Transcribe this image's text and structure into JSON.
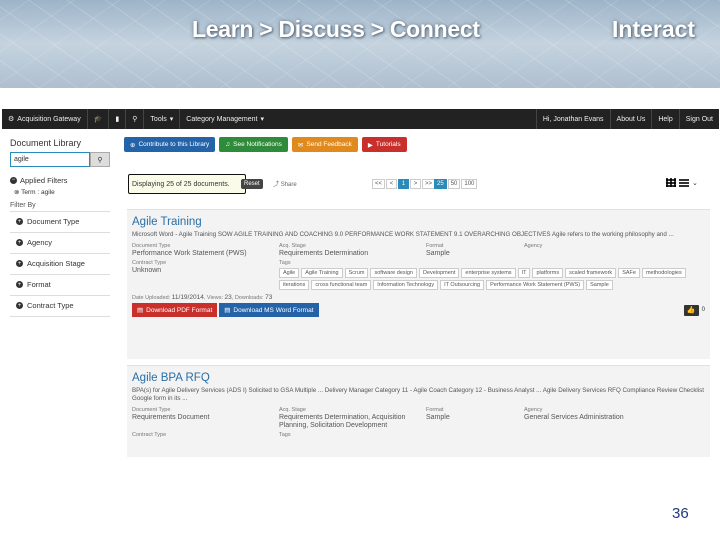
{
  "banner": {
    "title": "Learn > Discuss > Connect",
    "interact": "Interact"
  },
  "nav": {
    "brand": "Acquisition Gateway",
    "tools": "Tools",
    "category": "Category Management",
    "greeting": "Hi, Jonathan Evans",
    "about": "About Us",
    "help": "Help",
    "signout": "Sign Out"
  },
  "sidebar": {
    "title": "Document Library",
    "search_value": "agile",
    "applied_filters": "Applied Filters",
    "term": "Term : agile",
    "filter_by": "Filter By",
    "facets": [
      "Document Type",
      "Agency",
      "Acquisition Stage",
      "Format",
      "Contract Type"
    ]
  },
  "actions": {
    "contribute": "Contribute to this Library",
    "notifications": "See Notifications",
    "feedback": "Send Feedback",
    "tutorials": "Tutorials"
  },
  "toolbar": {
    "displaying": "Displaying 25 of 25 documents.",
    "reset": "Reset",
    "share": "Share",
    "pages": [
      "<<",
      "<",
      "1",
      ">",
      ">>"
    ],
    "active_page": "1",
    "sizes": [
      "25",
      "50",
      "100"
    ]
  },
  "results": [
    {
      "title": "Agile Training",
      "snippet": "Microsoft Word - Agile Training SOW AGILE TRAINING AND COACHING 9.0 PERFORMANCE WORK STATEMENT 9.1 OVERARCHING OBJECTIVES Agile refers to the working philosophy and ...",
      "labels": {
        "doc_type": "Document Type",
        "acq_stage": "Acq. Stage",
        "format": "Format",
        "agency": "Agency",
        "contract_type": "Contract Type",
        "tags": "Tags"
      },
      "doc_type": "Performance Work Statement (PWS)",
      "acq_stage": "Requirements Determination",
      "format": "Sample",
      "agency": "",
      "contract_type": "Unknown",
      "tags": [
        "Agile",
        "Agile Training",
        "Scrum",
        "software design",
        "Development",
        "enterprise systems",
        "IT",
        "platforms",
        "scaled framework",
        "SAFe",
        "methodologies",
        "iterations",
        "cross functional team",
        "Information Technology",
        "IT Outsourcing",
        "Performance Work Statement (PWS)",
        "Sample"
      ],
      "uploaded_label": "Date Uploaded:",
      "uploaded": "11/19/2014",
      "views_label": "Views:",
      "views": "23",
      "downloads_label": "Downloads:",
      "downloads": "73",
      "download_pdf": "Download PDF Format",
      "download_word": "Download MS Word Format",
      "likes": "0"
    },
    {
      "title": "Agile BPA RFQ",
      "snippet": "BPA(s) for Agile Delivery Services (ADS I) Solicited to GSA Multiple ... Delivery Manager Category 11 - Agile Coach Category 12 - Business Analyst ... Agile Delivery Services RFQ Compliance Review Checklist Google form in its ...",
      "labels": {
        "doc_type": "Document Type",
        "acq_stage": "Acq. Stage",
        "format": "Format",
        "agency": "Agency",
        "contract_type": "Contract Type",
        "tags": "Tags"
      },
      "doc_type": "Requirements Document",
      "acq_stage": "Requirements Determination, Acquisition Planning, Solicitation Development",
      "format": "Sample",
      "agency": "General Services Administration"
    }
  ],
  "slide_number": "36"
}
